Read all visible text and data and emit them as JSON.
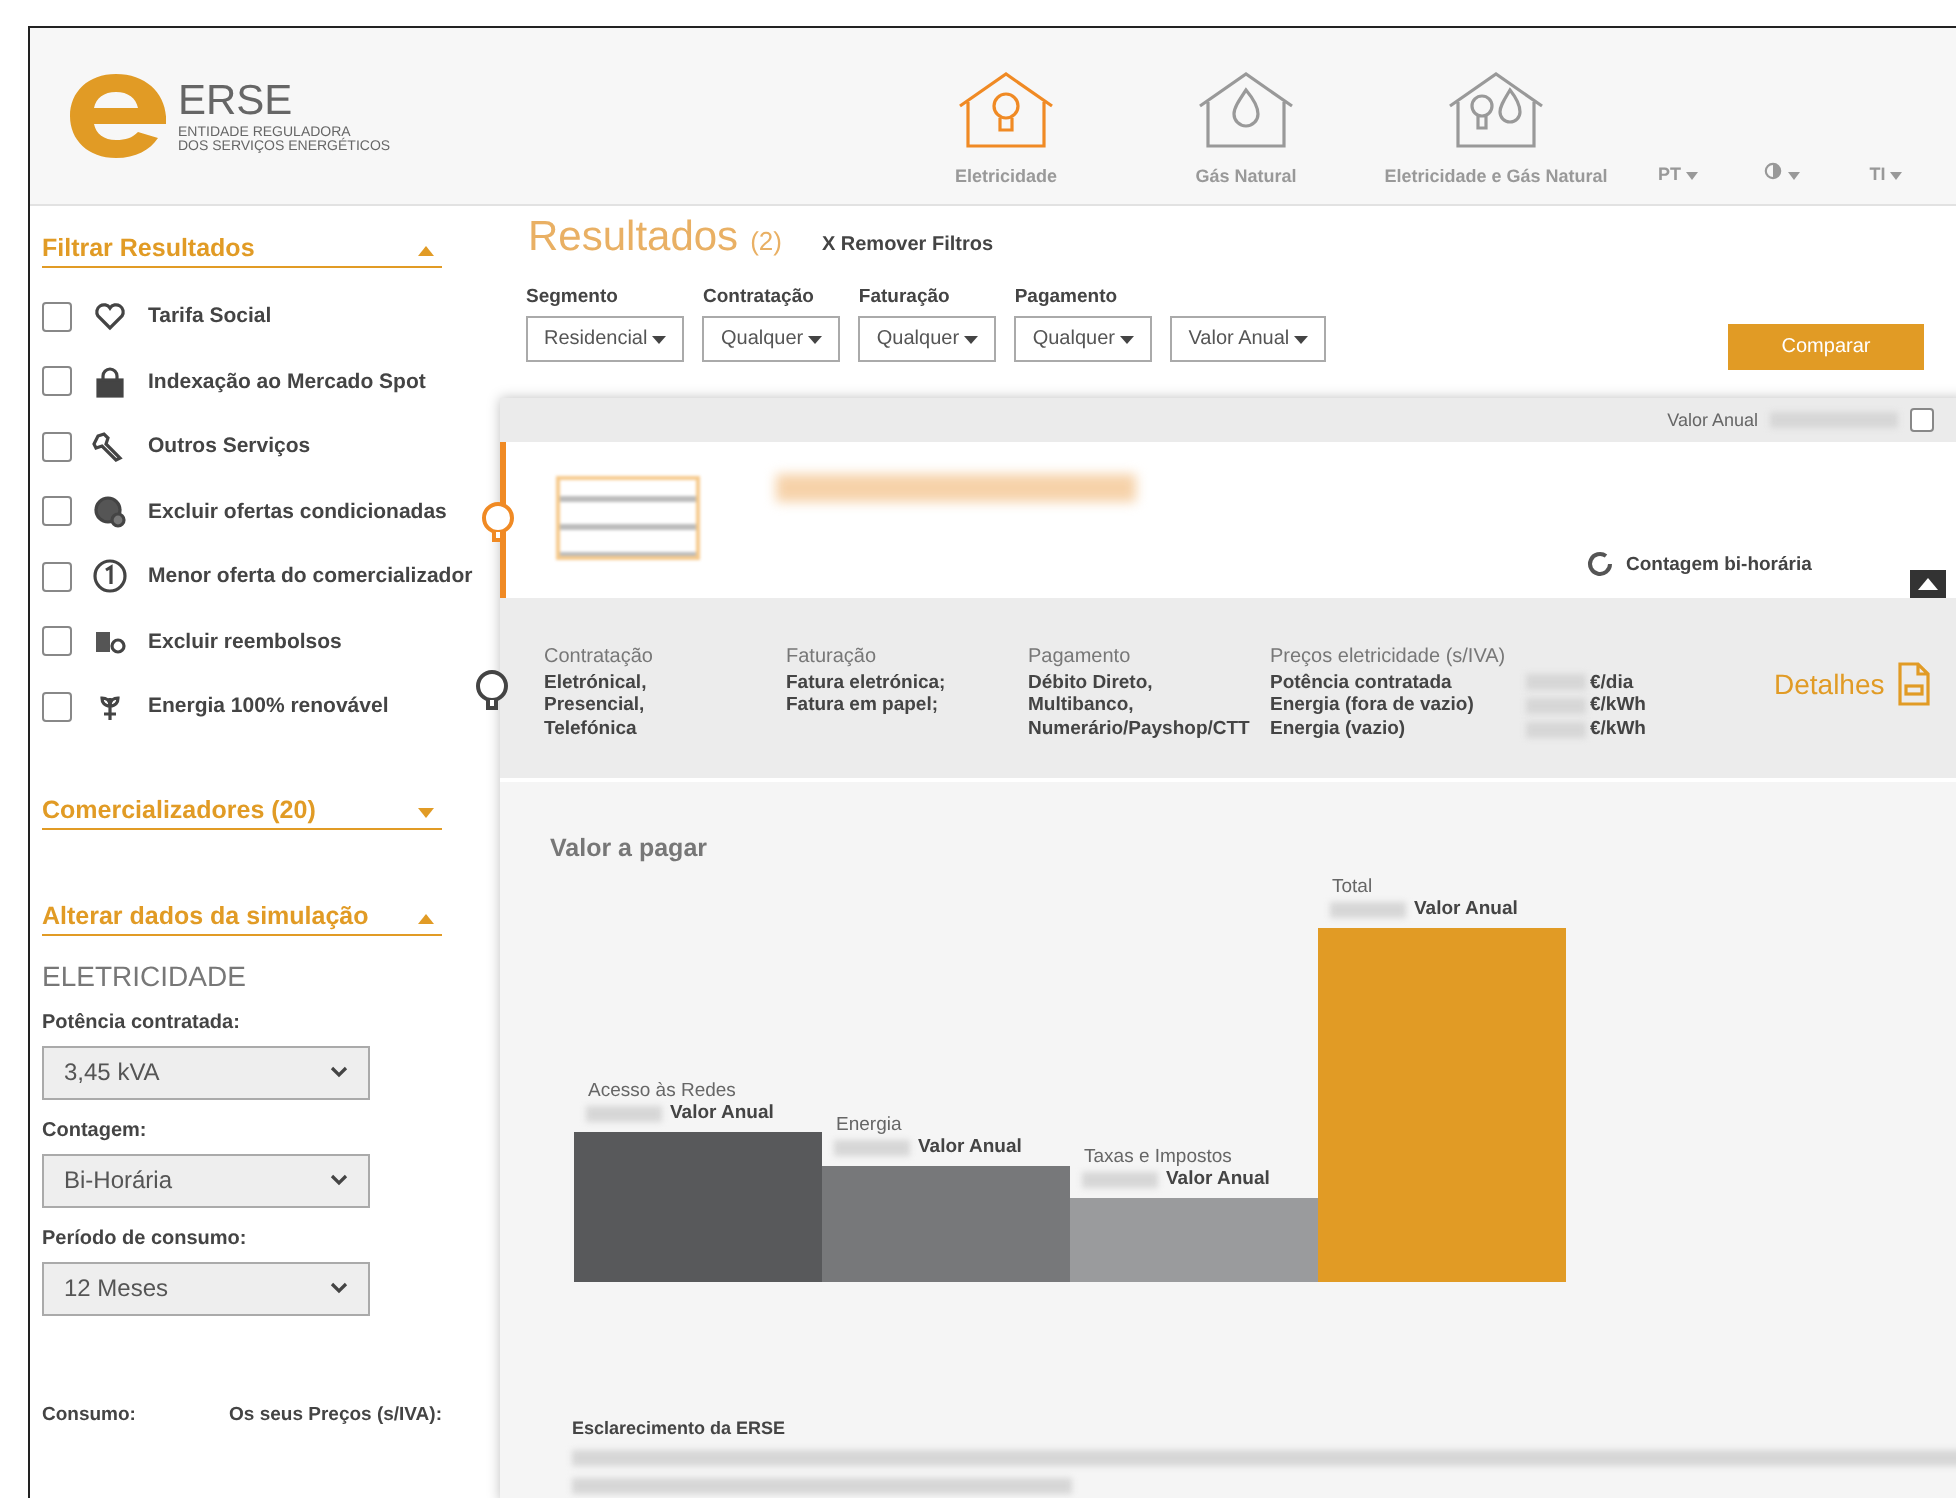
{
  "header": {
    "brand": "ERSE",
    "subtitle_lines": [
      "ENTIDADE REGULADORA",
      "DOS SERVIÇOS ENERGÉTICOS"
    ],
    "nav": [
      {
        "label": "Eletricidade",
        "selected": true,
        "kind": "bulb"
      },
      {
        "label": "Gás Natural",
        "selected": false,
        "kind": "flame"
      },
      {
        "label": "Eletricidade e Gás Natural",
        "selected": false,
        "kind": "both"
      }
    ],
    "menus": [
      {
        "kind": "text",
        "label": "PT"
      },
      {
        "kind": "contrast"
      },
      {
        "kind": "text",
        "label": "TI"
      }
    ]
  },
  "sidebar": {
    "filter_section": {
      "title": "Filtrar Resultados",
      "expanded": true
    },
    "filters": [
      {
        "label": "Tarifa Social",
        "checked": false,
        "kind": "heart"
      },
      {
        "label": "Indexação ao Mercado Spot",
        "checked": false,
        "kind": "lock"
      },
      {
        "label": "Outros Serviços",
        "checked": false,
        "kind": "wrench"
      },
      {
        "label": "Excluir ofertas condicionadas",
        "checked": false,
        "kind": "coin"
      },
      {
        "label": "Menor oferta do comercializador",
        "checked": false,
        "kind": "one"
      },
      {
        "label": "Excluir reembolsos",
        "checked": false,
        "kind": "coins"
      },
      {
        "label": "Energia 100% renovável",
        "checked": false,
        "kind": "plant"
      }
    ],
    "suppliers_section": {
      "title": "Comercializadores (20)",
      "expanded": false
    },
    "simulation_section": {
      "title": "Alterar dados da simulação",
      "expanded": true
    },
    "subtitle": "ELETRICIDADE",
    "fields": [
      {
        "label": "Potência contratada:",
        "value": "3,45 kVA"
      },
      {
        "label": "Contagem:",
        "value": "Bi-Horária"
      },
      {
        "label": "Período de consumo:",
        "value": "12 Meses"
      }
    ],
    "bottom_labels": [
      "Consumo:",
      "Os seus Preços (s/IVA):"
    ]
  },
  "results": {
    "title": "Resultados",
    "count": "(2)",
    "remove_filters": "X Remover Filtros",
    "dropdowns": [
      {
        "label": "Segmento",
        "value": "Residencial"
      },
      {
        "label": "Contratação",
        "value": "Qualquer"
      },
      {
        "label": "Faturação",
        "value": "Qualquer"
      },
      {
        "label": "Pagamento",
        "value": "Qualquer"
      },
      {
        "value": "Valor Anual"
      }
    ],
    "compare_button": "Comparar"
  },
  "offer": {
    "header_label": "Valor Anual",
    "compare_checked": false,
    "meter": "Contagem bi-horária",
    "columns": [
      {
        "title": "Contratação",
        "lines": [
          "Eletrónical,",
          "Presencial,",
          "Telefónica"
        ]
      },
      {
        "title": "Faturação",
        "lines": [
          "Fatura eletrónica;",
          "Fatura em papel;"
        ]
      },
      {
        "title": "Pagamento",
        "lines": [
          "Débito Direto,",
          "Multibanco,",
          "Numerário/Payshop/CTT"
        ]
      }
    ],
    "prices": {
      "title": "Preços eletricidade (s/IVA)",
      "rows": [
        {
          "label": "Potência contratada",
          "unit": "€/dia"
        },
        {
          "label": "Energia (fora de vazio)",
          "unit": "€/kWh"
        },
        {
          "label": "Energia (vazio)",
          "unit": "€/kWh"
        }
      ]
    },
    "details": "Detalhes"
  },
  "chart": {
    "title": "Valor a pagar",
    "bars": [
      {
        "label": "Acesso às Redes",
        "value_label": "Valor Anual",
        "color": "#58595b"
      },
      {
        "label": "Energia",
        "value_label": "Valor Anual",
        "color": "#77787a"
      },
      {
        "label": "Taxas e Impostos",
        "value_label": "Valor Anual",
        "color": "#9a9b9d"
      },
      {
        "label": "Total",
        "value_label": "Valor Anual",
        "color": "#e19b25"
      }
    ]
  },
  "note": {
    "title": "Esclarecimento da ERSE"
  }
}
